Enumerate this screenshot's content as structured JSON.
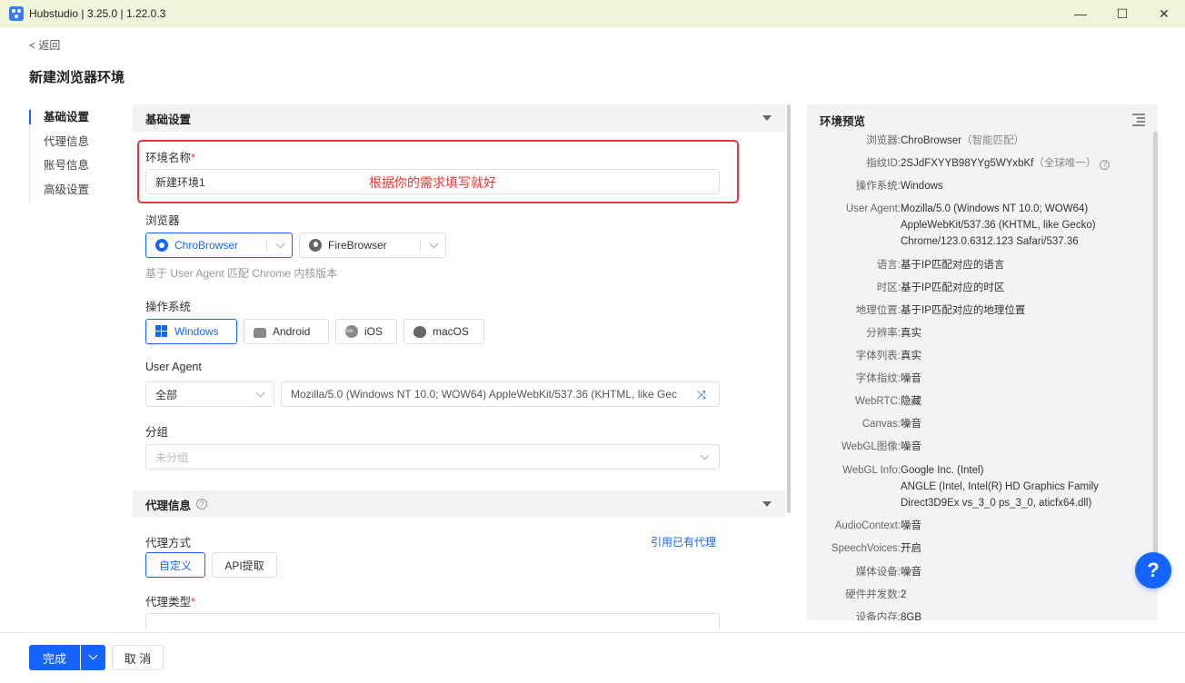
{
  "window": {
    "title": "Hubstudio | 3.25.0 | 1.22.0.3",
    "min": "—",
    "max": "☐",
    "close": "✕"
  },
  "header": {
    "back": "< 返回",
    "title": "新建浏览器环境"
  },
  "nav": {
    "items": [
      {
        "label": "基础设置"
      },
      {
        "label": "代理信息"
      },
      {
        "label": "账号信息"
      },
      {
        "label": "高级设置"
      }
    ]
  },
  "basic": {
    "section_title": "基础设置",
    "env_name_label": "环境名称",
    "required_mark": "*",
    "env_name_value": "新建环境1",
    "annotation": "根据你的需求填写就好",
    "browser_label": "浏览器",
    "browsers": [
      {
        "label": "ChroBrowser",
        "selected": true
      },
      {
        "label": "FireBrowser",
        "selected": false
      }
    ],
    "browser_hint": "基于 User Agent 匹配 Chrome 内核版本",
    "os_label": "操作系统",
    "os": [
      {
        "label": "Windows",
        "selected": true
      },
      {
        "label": "Android",
        "selected": false
      },
      {
        "label": "iOS",
        "selected": false
      },
      {
        "label": "macOS",
        "selected": false
      }
    ],
    "ua_label": "User Agent",
    "ua_filter": "全部",
    "ua_value": "Mozilla/5.0 (Windows NT 10.0; WOW64) AppleWebKit/537.36 (KHTML, like Gec",
    "group_label": "分组",
    "group_placeholder": "未分组"
  },
  "proxy": {
    "section_title": "代理信息",
    "mode_label": "代理方式",
    "use_existing_link": "引用已有代理",
    "modes": [
      {
        "label": "自定义",
        "selected": true
      },
      {
        "label": "API提取",
        "selected": false
      }
    ],
    "type_label": "代理类型"
  },
  "preview": {
    "title": "环境预览",
    "rows": [
      {
        "k": "浏览器:",
        "v": "ChroBrowser",
        "muted": "（智能匹配）"
      },
      {
        "k": "指纹ID:",
        "v": "2SJdFXYYB98YYg5WYxbKf",
        "muted": "（全球唯一）"
      },
      {
        "k": "操作系统:",
        "v": "Windows"
      },
      {
        "k": "User Agent:",
        "v": "Mozilla/5.0 (Windows NT 10.0; WOW64)",
        "v2": "AppleWebKit/537.36 (KHTML, like Gecko)",
        "v3": "Chrome/123.0.6312.123 Safari/537.36"
      },
      {
        "k": "语言:",
        "v": "基于IP匹配对应的语言"
      },
      {
        "k": "时区:",
        "v": "基于IP匹配对应的时区"
      },
      {
        "k": "地理位置:",
        "v": "基于IP匹配对应的地理位置"
      },
      {
        "k": "分辨率:",
        "v": "真实"
      },
      {
        "k": "字体列表:",
        "v": "真实"
      },
      {
        "k": "字体指纹:",
        "v": "噪音"
      },
      {
        "k": "WebRTC:",
        "v": "隐藏"
      },
      {
        "k": "Canvas:",
        "v": "噪音"
      },
      {
        "k": "WebGL图像:",
        "v": "噪音"
      },
      {
        "k": "WebGL Info:",
        "v": "Google Inc. (Intel)",
        "v2": "ANGLE (Intel, Intel(R) HD Graphics Family",
        "v3": "Direct3D9Ex vs_3_0 ps_3_0, aticfx64.dll)"
      },
      {
        "k": "AudioContext:",
        "v": "噪音"
      },
      {
        "k": "SpeechVoices:",
        "v": "开启"
      },
      {
        "k": "媒体设备:",
        "v": "噪音"
      },
      {
        "k": "硬件并发数:",
        "v": "2"
      },
      {
        "k": "设备内存:",
        "v": "8GB"
      }
    ]
  },
  "fab": {
    "label": "?"
  },
  "footer": {
    "done": "完成",
    "cancel": "取 消"
  }
}
